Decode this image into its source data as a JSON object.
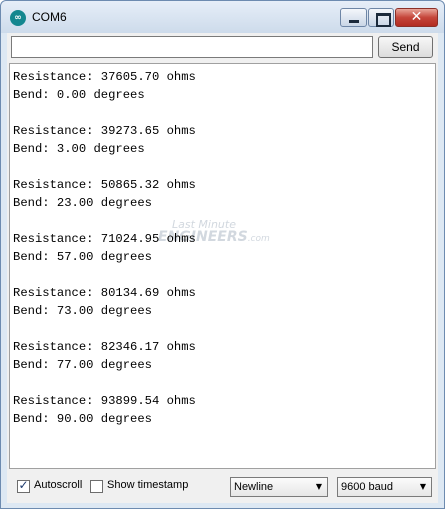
{
  "window": {
    "title": "COM6",
    "icon": "arduino-icon"
  },
  "input": {
    "value": "",
    "send_label": "Send"
  },
  "output": {
    "lines": [
      "Resistance: 37605.70 ohms",
      "Bend: 0.00 degrees",
      "",
      "Resistance: 39273.65 ohms",
      "Bend: 3.00 degrees",
      "",
      "Resistance: 50865.32 ohms",
      "Bend: 23.00 degrees",
      "",
      "Resistance: 71024.95 ohms",
      "Bend: 57.00 degrees",
      "",
      "Resistance: 80134.69 ohms",
      "Bend: 73.00 degrees",
      "",
      "Resistance: 82346.17 ohms",
      "Bend: 77.00 degrees",
      "",
      "Resistance: 93899.54 ohms",
      "Bend: 90.00 degrees"
    ]
  },
  "watermark": {
    "line1": "Last Minute",
    "line2": "ENGINEERS",
    "suffix": ".com"
  },
  "footer": {
    "autoscroll_label": "Autoscroll",
    "autoscroll_checked": true,
    "timestamp_label": "Show timestamp",
    "timestamp_checked": false,
    "line_ending": "Newline",
    "baud": "9600 baud"
  },
  "colors": {
    "icon_teal": "#14878f",
    "close_red": "#c5453a"
  }
}
